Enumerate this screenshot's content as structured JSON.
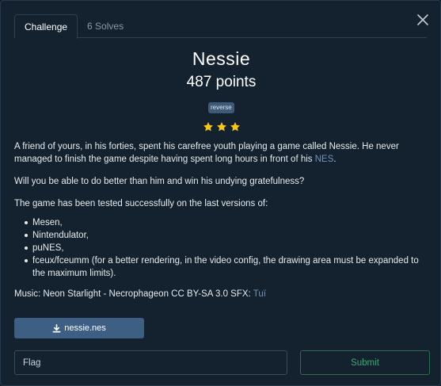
{
  "tabs": [
    {
      "label": "Challenge",
      "active": true
    },
    {
      "label": "6 Solves",
      "active": false
    }
  ],
  "challenge": {
    "name": "Nessie",
    "points": "487 points",
    "tag": "reverse",
    "stars": 3
  },
  "description": {
    "p1_part1": "A friend of yours, in his forties, spent his carefree youth playing a game called Nessie. He never managed to finish the game despite having spent long hours in front of his ",
    "p1_link": "NES",
    "p1_end": ".",
    "p2": "Will you be able to do better than him and win his undying gratefulness?",
    "p3": "The game has been tested successfully on the last versions of:",
    "emulators": [
      "Mesen,",
      "Nintendulator,",
      "puNES,",
      "fceux/fceumm (for a better rendering, in the video config, the drawing area must be expanded to the maximum limits)."
    ],
    "music_text": "Music: Neon Starlight - Necrophageon CC BY-SA 3.0 SFX: ",
    "music_link": "Tuï"
  },
  "download": {
    "label": "nessie.nes"
  },
  "flag": {
    "placeholder": "Flag",
    "value": ""
  },
  "submit": {
    "label": "Submit"
  },
  "colors": {
    "accent": "#3d5f84",
    "success": "#3fa673",
    "star": "#f5c518",
    "link": "#6f93b8"
  }
}
